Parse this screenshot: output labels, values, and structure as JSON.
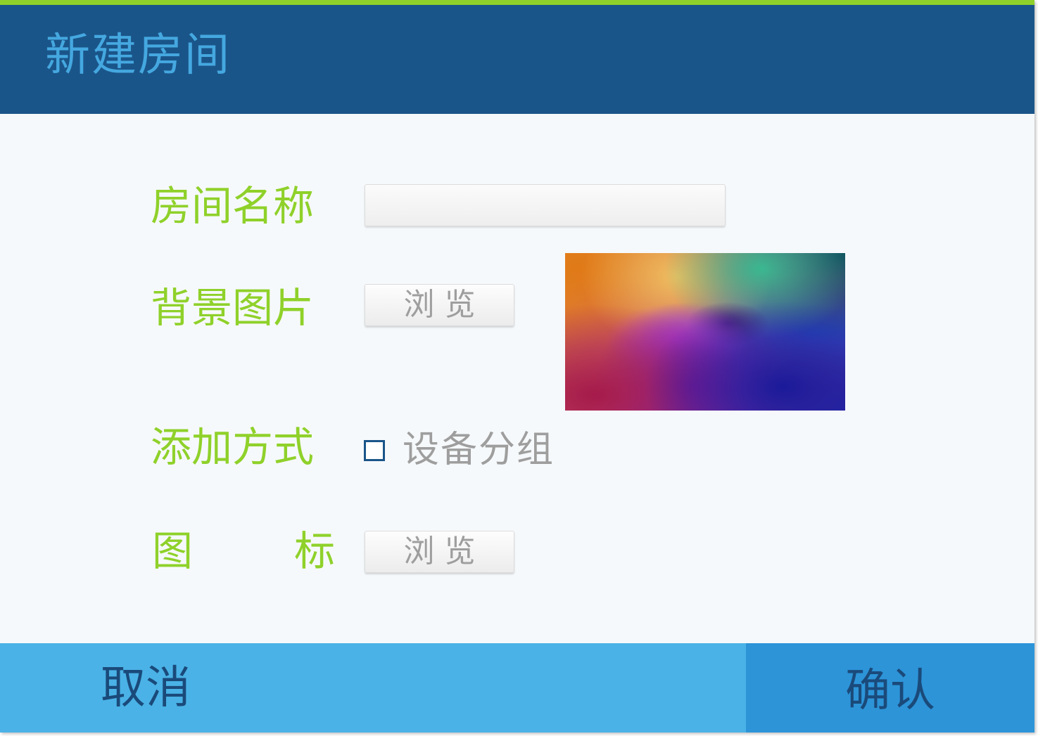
{
  "dialog": {
    "title": "新建房间"
  },
  "form": {
    "room_name_label": "房间名称",
    "room_name_value": "",
    "background_image_label": "背景图片",
    "background_browse_label": "浏览",
    "add_mode_label": "添加方式",
    "device_group_option": "设备分组",
    "device_group_checked": false,
    "icon_label_part1": "图",
    "icon_label_part2": "标",
    "icon_browse_label": "浏览"
  },
  "footer": {
    "cancel_label": "取消",
    "confirm_label": "确认"
  },
  "colors": {
    "header_bg": "#1a5589",
    "title_text": "#45a8e0",
    "accent_green": "#8fd12a",
    "cancel_bg": "#4ab2e6",
    "confirm_bg": "#2d94d8",
    "footer_text": "#1a4a7a"
  }
}
